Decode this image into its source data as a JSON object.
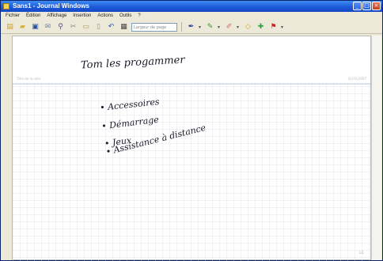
{
  "window": {
    "title": "Sans1 - Journal Windows"
  },
  "menu": {
    "items": [
      "Fichier",
      "Édition",
      "Affichage",
      "Insertion",
      "Actions",
      "Outils",
      "?"
    ]
  },
  "toolbar": {
    "zoom_label": "Largeur de page",
    "icons": [
      "new-icon",
      "open-icon",
      "save-icon",
      "mail-icon",
      "search-icon",
      "cut-icon",
      "paste-icon",
      "insert-icon",
      "undo-icon",
      "view-icon",
      "pen-icon",
      "highlighter-icon",
      "eraser-icon",
      "selection-icon",
      "insert-space-icon",
      "flag-icon"
    ]
  },
  "page": {
    "header_left": "Titre de la note",
    "header_right": "01/01/2007",
    "page_number": "1/1",
    "title_handwritten": "Tom les progammer",
    "bullets": [
      "Accessoires",
      "Démarrage",
      "Jeux",
      "Assistance à distance"
    ]
  },
  "colors": {
    "titlebar": "#1d5ad8",
    "chrome": "#ece9d8",
    "grid": "#d6dbe6",
    "ink": "#1a1a2a"
  }
}
